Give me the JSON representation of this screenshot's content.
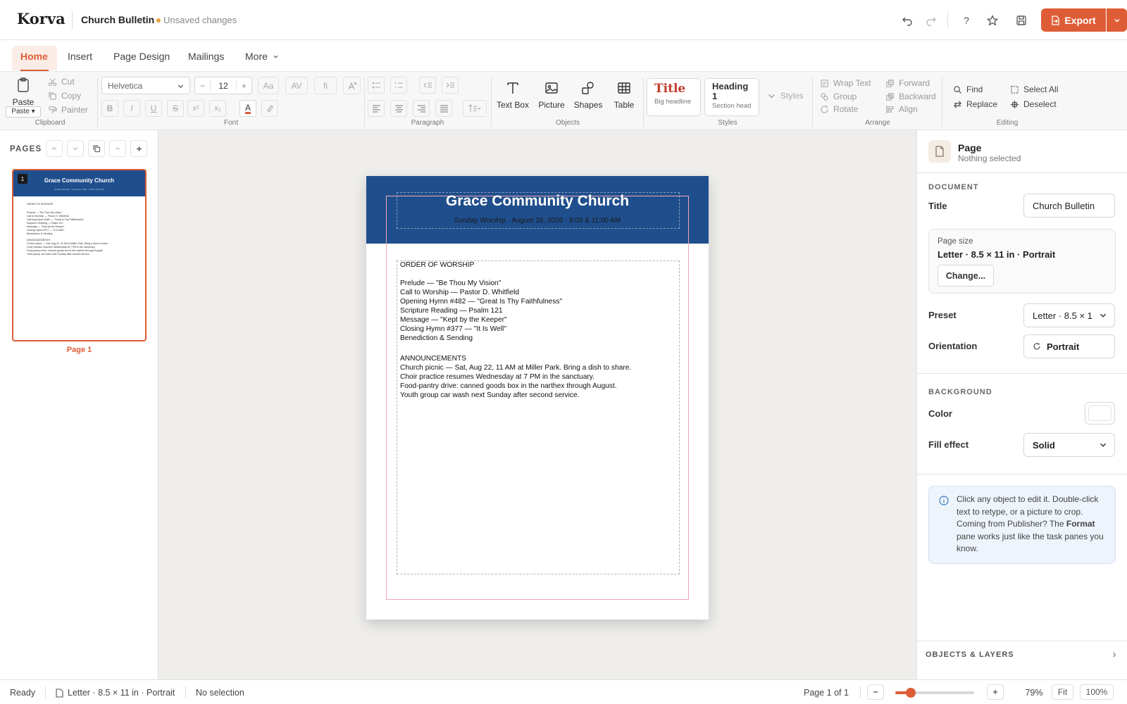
{
  "app": {
    "name": "Korva",
    "doc_title": "Church Bulletin",
    "status": "Unsaved changes",
    "export_label": "Export"
  },
  "colors": {
    "accent": "#de5d36",
    "header_blue": "#1f4e8c",
    "unsaved_dot": "#e6a13c"
  },
  "tabs": [
    "Home",
    "Insert",
    "Page Design",
    "Mailings",
    "More"
  ],
  "ribbon": {
    "clipboard": {
      "paste": "Paste",
      "paste_menu": "Paste ▾",
      "cut": "Cut",
      "copy": "Copy",
      "painter": "Painter",
      "label": "Clipboard"
    },
    "font": {
      "family": "Helvetica",
      "size": "12",
      "case": "Aa",
      "spacing": "AV",
      "ligature": "fi",
      "bold": "B",
      "italic": "I",
      "underline": "U",
      "strike": "S",
      "superscript": "x²",
      "subscript": "x₂",
      "color_letter": "A",
      "label": "Font"
    },
    "paragraph": {
      "label": "Paragraph"
    },
    "objects": {
      "text_box": "Text Box",
      "picture": "Picture",
      "shapes": "Shapes",
      "table": "Table",
      "label": "Objects"
    },
    "styles": {
      "title_name": "Title",
      "title_desc": "Big headline",
      "heading_name": "Heading 1",
      "heading_desc": "Section head",
      "more": "Styles",
      "label": "Styles"
    },
    "arrange": {
      "wrap_text": "Wrap Text",
      "group": "Group",
      "rotate": "Rotate",
      "forward": "Forward",
      "backward": "Backward",
      "align": "Align",
      "label": "Arrange"
    },
    "editing": {
      "find": "Find",
      "replace": "Replace",
      "select_all": "Select All",
      "deselect": "Deselect",
      "label": "Editing"
    }
  },
  "pages_panel": {
    "title": "PAGES",
    "page_number": "1",
    "page_caption": "Page 1"
  },
  "bulletin": {
    "title": "Grace Community Church",
    "subtitle": "Sunday Worship · August 16, 2026 · 9:00 & 11:00 AM",
    "worship_heading": "ORDER OF WORSHIP",
    "worship_items": [
      "Prelude — \"Be Thou My Vision\"",
      "Call to Worship — Pastor D. Whitfield",
      "Opening Hymn #482 — \"Great Is Thy Faithfulness\"",
      "Scripture Reading — Psalm 121",
      "Message — \"Kept by the Keeper\"",
      "Closing Hymn #377 — \"It Is Well\"",
      "Benediction & Sending"
    ],
    "announcements_heading": "ANNOUNCEMENTS",
    "announcements": [
      "Church picnic — Sat, Aug 22, 11 AM at Miller Park. Bring a dish to share.",
      "Choir practice resumes Wednesday at 7 PM in the sanctuary.",
      "Food-pantry drive: canned goods box in the narthex through August.",
      "Youth group car wash next Sunday after second service."
    ]
  },
  "right_panel": {
    "title": "Page",
    "subtitle": "Nothing selected",
    "document_section": "DOCUMENT",
    "title_label": "Title",
    "title_value": "Church Bulletin",
    "page_size_label": "Page size",
    "page_size_value": "Letter · 8.5 × 11 in · Portrait",
    "change_button": "Change...",
    "preset_label": "Preset",
    "preset_value": "Letter · 8.5 × 1",
    "orientation_label": "Orientation",
    "orientation_value": "Portrait",
    "background_section": "BACKGROUND",
    "color_label": "Color",
    "color_value": "#ffffff",
    "fill_label": "Fill effect",
    "fill_value": "Solid",
    "info_before": "Click any object to edit it. Double-click text to retype, or a picture to crop. Coming from Publisher? The ",
    "info_bold": "Format",
    "info_after": " pane works just like the task panes you know.",
    "objects_layers": "OBJECTS & LAYERS"
  },
  "status": {
    "ready": "Ready",
    "page_size": "Letter · 8.5 × 11 in · Portrait",
    "selection": "No selection",
    "page_of": "Page 1 of 1",
    "zoom": "79%",
    "zoom_fraction": 0.2,
    "fit": "Fit",
    "hundred": "100%"
  }
}
